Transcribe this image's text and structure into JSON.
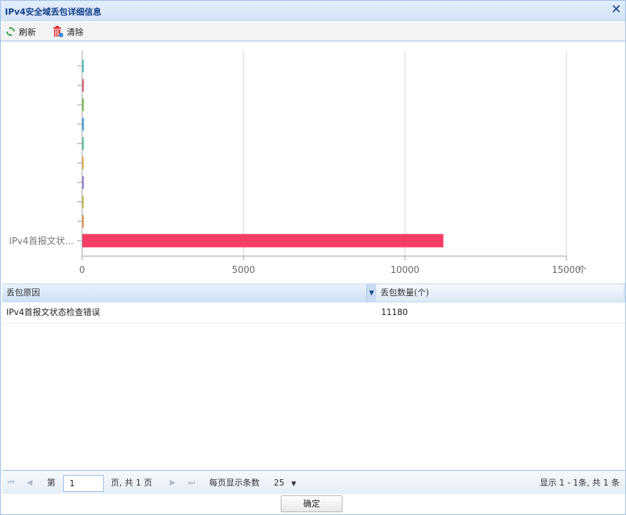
{
  "window": {
    "title": "IPv4安全域丢包详细信息",
    "close_icon": "close-icon"
  },
  "toolbar": {
    "refresh_label": "刷新",
    "refresh_icon": "refresh-icon",
    "clear_label": "清除",
    "clear_icon": "trash-icon"
  },
  "chart_data": {
    "type": "bar",
    "orientation": "horizontal",
    "categories": [
      "",
      "",
      "",
      "",
      "",
      "",
      "",
      "",
      "",
      "IPv4首报文状..."
    ],
    "values": [
      0,
      0,
      0,
      0,
      0,
      0,
      0,
      0,
      0,
      11180
    ],
    "bar_colors": [
      "#4ec9c6",
      "#f0566e",
      "#7dc24d",
      "#3a9ee0",
      "#4ec9a0",
      "#f3b84b",
      "#9b7be0",
      "#c8c84b",
      "#f09a4b",
      "#f53d66"
    ],
    "xticks": [
      "0",
      "5000",
      "10000",
      "15000"
    ],
    "xlim": [
      0,
      15000
    ],
    "xunit": "个",
    "grid": true
  },
  "grid": {
    "columns": [
      "丢包原因",
      "丢包数量(个)"
    ],
    "rows": [
      {
        "reason": "IPv4首报文状态检查错误",
        "count": "11180"
      }
    ]
  },
  "pager": {
    "page_prefix": "第",
    "page_value": "1",
    "page_suffix": "页, 共 1 页",
    "per_page_label": "每页显示条数",
    "per_page_value": "25",
    "summary": "显示 1 - 1条, 共 1 条"
  },
  "footer": {
    "ok_label": "确定"
  }
}
